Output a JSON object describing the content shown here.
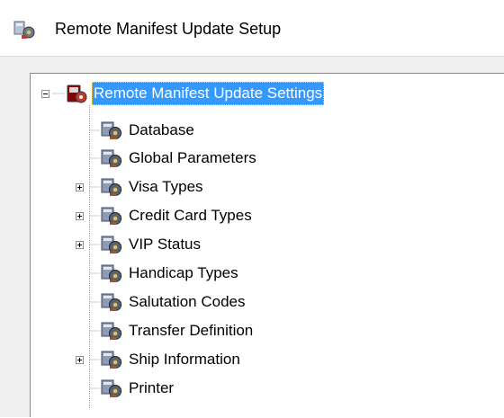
{
  "window": {
    "title": "Remote Manifest Update Setup",
    "icon": "app-settings-icon"
  },
  "tree": {
    "root": {
      "label": "Remote Manifest Update Settings",
      "icon": "remote-settings-icon",
      "expanded": true,
      "selected": true
    },
    "items": [
      {
        "label": "Database",
        "icon": "settings-gear-icon",
        "expandable": false
      },
      {
        "label": "Global Parameters",
        "icon": "settings-gear-icon",
        "expandable": false
      },
      {
        "label": "Visa Types",
        "icon": "settings-gear-icon",
        "expandable": true
      },
      {
        "label": "Credit Card Types",
        "icon": "settings-gear-icon",
        "expandable": true
      },
      {
        "label": "VIP Status",
        "icon": "settings-gear-icon",
        "expandable": true
      },
      {
        "label": "Handicap Types",
        "icon": "settings-gear-icon",
        "expandable": false
      },
      {
        "label": "Salutation Codes",
        "icon": "settings-gear-icon",
        "expandable": false
      },
      {
        "label": "Transfer Definition",
        "icon": "settings-gear-icon",
        "expandable": false
      },
      {
        "label": "Ship Information",
        "icon": "settings-gear-icon",
        "expandable": true
      },
      {
        "label": "Printer",
        "icon": "settings-gear-icon",
        "expandable": false
      }
    ]
  },
  "colors": {
    "selection": "#3399ff",
    "frame": "#f0f0f0",
    "panel_border": "#828790"
  }
}
